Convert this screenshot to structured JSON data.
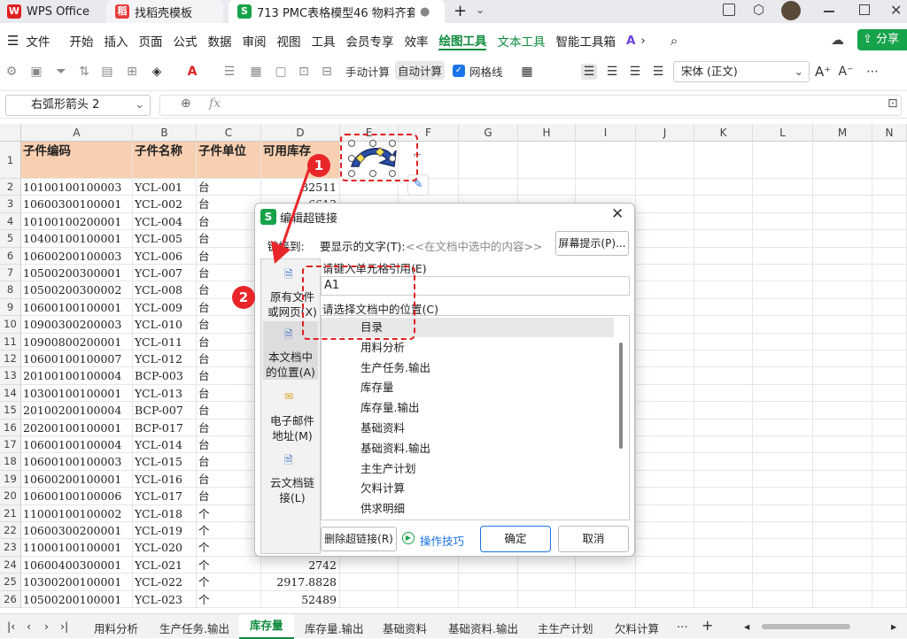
{
  "titlebar": {
    "tabs": [
      {
        "label": "WPS Office",
        "icon": "W"
      },
      {
        "label": "找稻壳模板",
        "icon": "稻"
      },
      {
        "label": "713 PMC表格模型46 物料齐套欠",
        "icon": "S"
      }
    ],
    "new_tab": "+"
  },
  "menu": {
    "file": "文件",
    "items": [
      "开始",
      "插入",
      "页面",
      "公式",
      "数据",
      "审阅",
      "视图",
      "工具",
      "会员专享",
      "效率"
    ],
    "green_items": [
      "绘图工具",
      "文本工具"
    ],
    "smart": "智能工具箱",
    "share": "分享"
  },
  "toolbar": {
    "manual_calc": "手动计算",
    "auto_calc": "自动计算",
    "gridlines": "网格线",
    "font": "宋体 (正文)"
  },
  "formula": {
    "namebox": "右弧形箭头 2",
    "fx": "fx"
  },
  "columns": [
    "A",
    "B",
    "C",
    "D",
    "E",
    "F",
    "G",
    "H",
    "I",
    "J",
    "K",
    "L",
    "M",
    "N"
  ],
  "header_row": {
    "a": "子件编码",
    "b": "子件名称",
    "c": "子件单位",
    "d": "可用库存"
  },
  "rows": [
    {
      "n": "2",
      "a": "10100100100003",
      "b": "YCL-001",
      "c": "台",
      "d": "32511"
    },
    {
      "n": "3",
      "a": "10600300100001",
      "b": "YCL-002",
      "c": "台",
      "d": "6613"
    },
    {
      "n": "4",
      "a": "10100100200001",
      "b": "YCL-004",
      "c": "台",
      "d": ""
    },
    {
      "n": "5",
      "a": "10400100100001",
      "b": "YCL-005",
      "c": "台",
      "d": ""
    },
    {
      "n": "6",
      "a": "10600200100003",
      "b": "YCL-006",
      "c": "台",
      "d": ""
    },
    {
      "n": "7",
      "a": "10500200300001",
      "b": "YCL-007",
      "c": "台",
      "d": ""
    },
    {
      "n": "8",
      "a": "10500200300002",
      "b": "YCL-008",
      "c": "台",
      "d": ""
    },
    {
      "n": "9",
      "a": "10600100100001",
      "b": "YCL-009",
      "c": "台",
      "d": ""
    },
    {
      "n": "10",
      "a": "10900300200003",
      "b": "YCL-010",
      "c": "台",
      "d": ""
    },
    {
      "n": "11",
      "a": "10900800200001",
      "b": "YCL-011",
      "c": "台",
      "d": ""
    },
    {
      "n": "12",
      "a": "10600100100007",
      "b": "YCL-012",
      "c": "台",
      "d": ""
    },
    {
      "n": "13",
      "a": "20100100100004",
      "b": "BCP-003",
      "c": "台",
      "d": ""
    },
    {
      "n": "14",
      "a": "10300100100001",
      "b": "YCL-013",
      "c": "台",
      "d": ""
    },
    {
      "n": "15",
      "a": "20100200100004",
      "b": "BCP-007",
      "c": "台",
      "d": ""
    },
    {
      "n": "16",
      "a": "20200100100001",
      "b": "BCP-017",
      "c": "台",
      "d": ""
    },
    {
      "n": "17",
      "a": "10600100100004",
      "b": "YCL-014",
      "c": "台",
      "d": ""
    },
    {
      "n": "18",
      "a": "10600100100003",
      "b": "YCL-015",
      "c": "台",
      "d": ""
    },
    {
      "n": "19",
      "a": "10600200100001",
      "b": "YCL-016",
      "c": "台",
      "d": ""
    },
    {
      "n": "20",
      "a": "10600100100006",
      "b": "YCL-017",
      "c": "台",
      "d": ""
    },
    {
      "n": "21",
      "a": "11000100100002",
      "b": "YCL-018",
      "c": "个",
      "d": ""
    },
    {
      "n": "22",
      "a": "10600300200001",
      "b": "YCL-019",
      "c": "个",
      "d": ""
    },
    {
      "n": "23",
      "a": "11000100100001",
      "b": "YCL-020",
      "c": "个",
      "d": ""
    },
    {
      "n": "24",
      "a": "10600400300001",
      "b": "YCL-021",
      "c": "个",
      "d": "2742"
    },
    {
      "n": "25",
      "a": "10300200100001",
      "b": "YCL-022",
      "c": "个",
      "d": "2917.8828"
    },
    {
      "n": "26",
      "a": "10500200100001",
      "b": "YCL-023",
      "c": "个",
      "d": "52489"
    }
  ],
  "dialog": {
    "title": "编辑超链接",
    "link_to": "链接到:",
    "display_text_label": "要显示的文字(T):",
    "display_text_placeholder": "<<在文档中选中的内容>>",
    "screen_tip": "屏幕提示(P)...",
    "nav": [
      {
        "label": "原有文件或网页(X)"
      },
      {
        "label": "本文档中的位置(A)"
      },
      {
        "label": "电子邮件地址(M)"
      },
      {
        "label": "云文档链接(L)"
      }
    ],
    "cell_ref_label": "请键入单元格引用(E)",
    "cell_ref_value": "A1",
    "location_label": "请选择文档中的位置(C)",
    "locations": [
      "目录",
      "用料分析",
      "生产任务.输出",
      "库存量",
      "库存量.输出",
      "基础资料",
      "基础资料.输出",
      "主生产计划",
      "欠料计算",
      "供求明细"
    ],
    "remove_link": "删除超链接(R)",
    "tips": "操作技巧",
    "ok": "确定",
    "cancel": "取消"
  },
  "badges": [
    "1",
    "2"
  ],
  "sheets": [
    "用料分析",
    "生产任务.输出",
    "库存量",
    "库存量.输出",
    "基础资料",
    "基础资料.输出",
    "主生产计划",
    "欠料计算"
  ],
  "active_sheet": "库存量",
  "colors": {
    "accent": "#0d8b3c",
    "header_fill": "#f8cfb0",
    "annotation": "#e02020"
  }
}
